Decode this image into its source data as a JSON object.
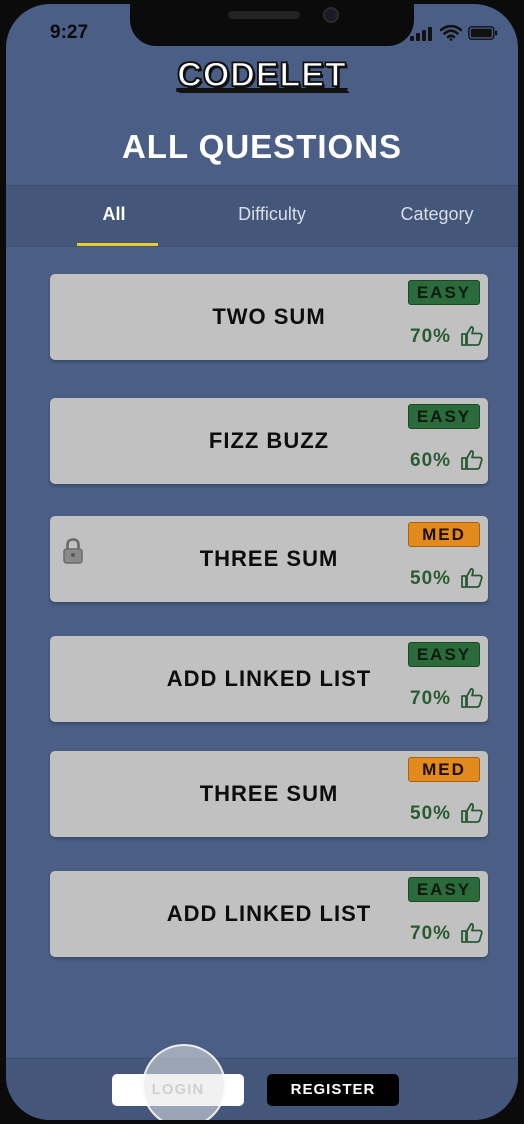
{
  "status_bar": {
    "time": "9:27",
    "icons": [
      "signal-icon",
      "wifi-icon",
      "battery-icon"
    ]
  },
  "header": {
    "app_title": "CODELET",
    "page_heading": "ALL QUESTIONS"
  },
  "tabs": [
    {
      "label": "All",
      "active": true
    },
    {
      "label": "Difficulty",
      "active": false
    },
    {
      "label": "Category",
      "active": false
    }
  ],
  "questions": [
    {
      "title": "TWO SUM",
      "difficulty": "EASY",
      "like_percent": "70%",
      "locked": false
    },
    {
      "title": "FIZZ BUZZ",
      "difficulty": "EASY",
      "like_percent": "60%",
      "locked": false
    },
    {
      "title": "THREE SUM",
      "difficulty": "MED",
      "like_percent": "50%",
      "locked": true
    },
    {
      "title": "ADD LINKED LIST",
      "difficulty": "EASY",
      "like_percent": "70%",
      "locked": false
    },
    {
      "title": "THREE SUM",
      "difficulty": "MED",
      "like_percent": "50%",
      "locked": false
    },
    {
      "title": "ADD LINKED LIST",
      "difficulty": "EASY",
      "like_percent": "70%",
      "locked": false
    }
  ],
  "bottom_bar": {
    "login_label": "LOGIN",
    "register_label": "REGISTER"
  },
  "colors": {
    "background": "#4b5f86",
    "tab_indicator": "#e2cd2a",
    "card": "#c1c1c1",
    "easy_badge": "#2b6a3a",
    "med_badge": "#e38a1c",
    "like_text": "#2a5a34"
  }
}
